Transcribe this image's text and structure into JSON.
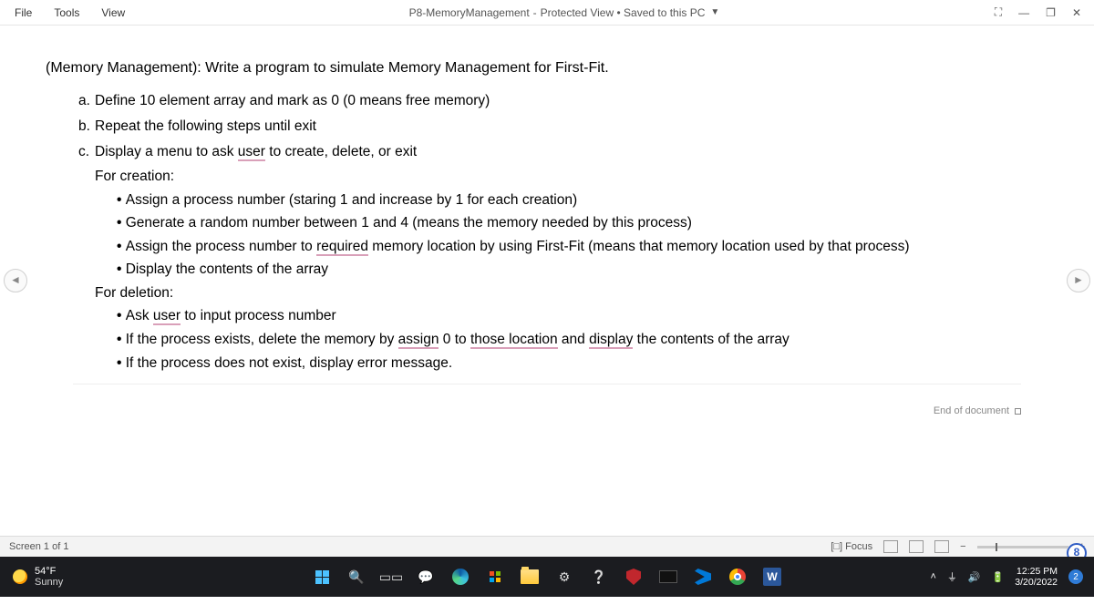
{
  "titlebar": {
    "menus": [
      "File",
      "Tools",
      "View"
    ],
    "doc_name": "P8-MemoryManagement",
    "view_state": "Protected View • Saved to this PC"
  },
  "document": {
    "heading": "(Memory Management): Write a program to simulate Memory Management for First-Fit.",
    "item_a": "Define 10 element array and mark as 0 (0 means free memory)",
    "item_b": "Repeat the following steps until exit",
    "item_c_pre": "Display a menu to ask ",
    "item_c_user": "user",
    "item_c_post": " to create, delete, or exit",
    "for_creation": "For creation:",
    "c1": "Assign a process number (staring 1 and increase by 1 for each creation)",
    "c2": "Generate a random number between 1 and 4 (means the memory needed by this process)",
    "c3_pre": "Assign the process number to ",
    "c3_req": "required",
    "c3_post": " memory location by using First-Fit (means that memory location used by that process)",
    "c4": "Display the contents of the array",
    "for_deletion": "For deletion:",
    "d1_pre": "Ask ",
    "d1_user": "user",
    "d1_post": " to input process number",
    "d2_pre": "If the process exists, delete the memory by ",
    "d2_assign": "assign",
    "d2_mid": " 0 to ",
    "d2_loc": "those location",
    "d2_mid2": " and ",
    "d2_disp": "display",
    "d2_post": " the contents of the array",
    "d3": "If the process does not exist, display error message.",
    "end_marker": "End of document",
    "badge": "8"
  },
  "statusbar": {
    "screen": "Screen 1 of 1",
    "focus": "Focus"
  },
  "taskbar": {
    "temp": "54°F",
    "condition": "Sunny",
    "time": "12:25 PM",
    "date": "3/20/2022",
    "notif_count": "2"
  }
}
